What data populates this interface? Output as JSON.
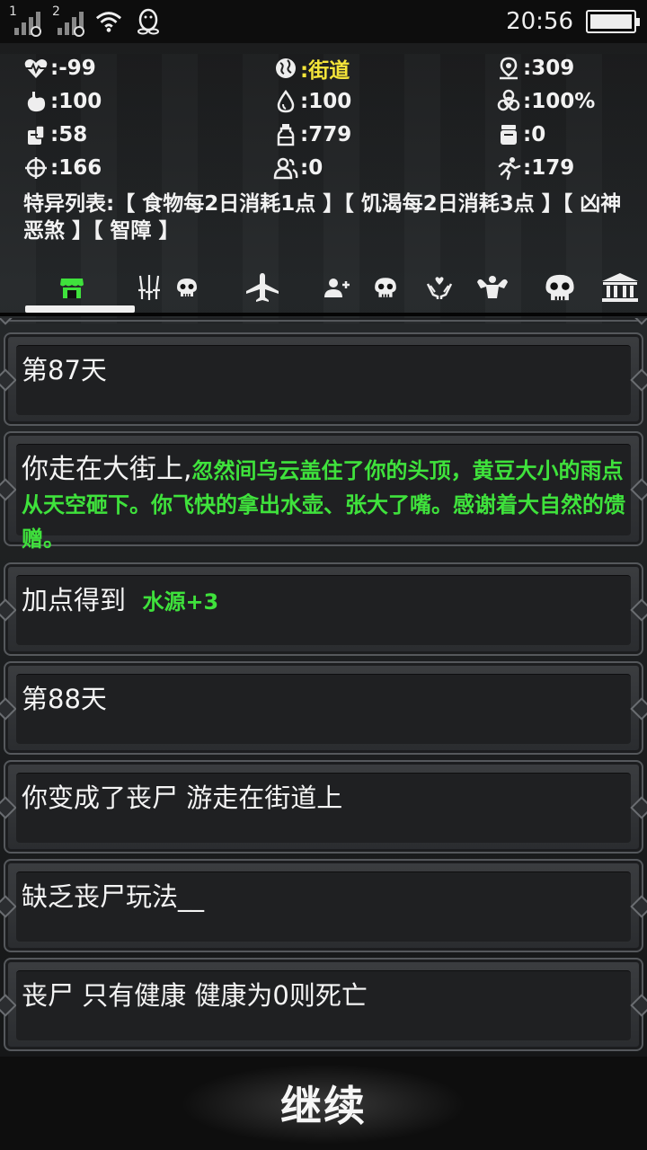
{
  "status_bar": {
    "sim1": "1",
    "sim2": "2",
    "time": "20:56",
    "battery_level": 1.0
  },
  "stats": {
    "health": ":-99",
    "location": ":街道",
    "distance": ":309",
    "hunger": ":100",
    "thirst": ":100",
    "infection": ":100%",
    "food": ":58",
    "water": ":779",
    "medicine": ":0",
    "weapon": ":166",
    "companions": ":0",
    "speed": ":179"
  },
  "traits": "特异列表:【 食物每2日消耗1点 】【 饥渴每2日消耗3点 】【 凶神恶煞 】【 智障 】",
  "tabs": [
    {
      "name": "shop",
      "icon": "shop-icon"
    },
    {
      "name": "weapons",
      "icon": "weapons-icon"
    },
    {
      "name": "skull-small",
      "icon": "skull-icon"
    },
    {
      "name": "travel",
      "icon": "airplane-icon"
    },
    {
      "name": "recruit",
      "icon": "add-person-icon"
    },
    {
      "name": "skull-2",
      "icon": "skull-icon"
    },
    {
      "name": "heal",
      "icon": "heal-hands-icon"
    },
    {
      "name": "strength",
      "icon": "muscle-icon"
    },
    {
      "name": "death",
      "icon": "skull-large-icon"
    },
    {
      "name": "bank",
      "icon": "bank-icon"
    }
  ],
  "log": {
    "day87": "第87天",
    "rain_intro": "你走在大街上,",
    "rain_event": "忽然间乌云盖住了你的头顶，黄豆大小的雨点从天空砸下。你飞快的拿出水壶、张大了嘴。感谢着大自然的馈赠。",
    "gain_label": "加点得到",
    "gain_value": "水源+3",
    "day88": "第88天",
    "zombie": "你变成了丧尸 游走在街道上",
    "lacking": "缺乏丧尸玩法__",
    "zombie_rule": "丧尸 只有健康 健康为0则死亡"
  },
  "continue_label": "继续",
  "colors": {
    "accent_green": "#3fe23c",
    "accent_yellow": "#f5e53a"
  }
}
